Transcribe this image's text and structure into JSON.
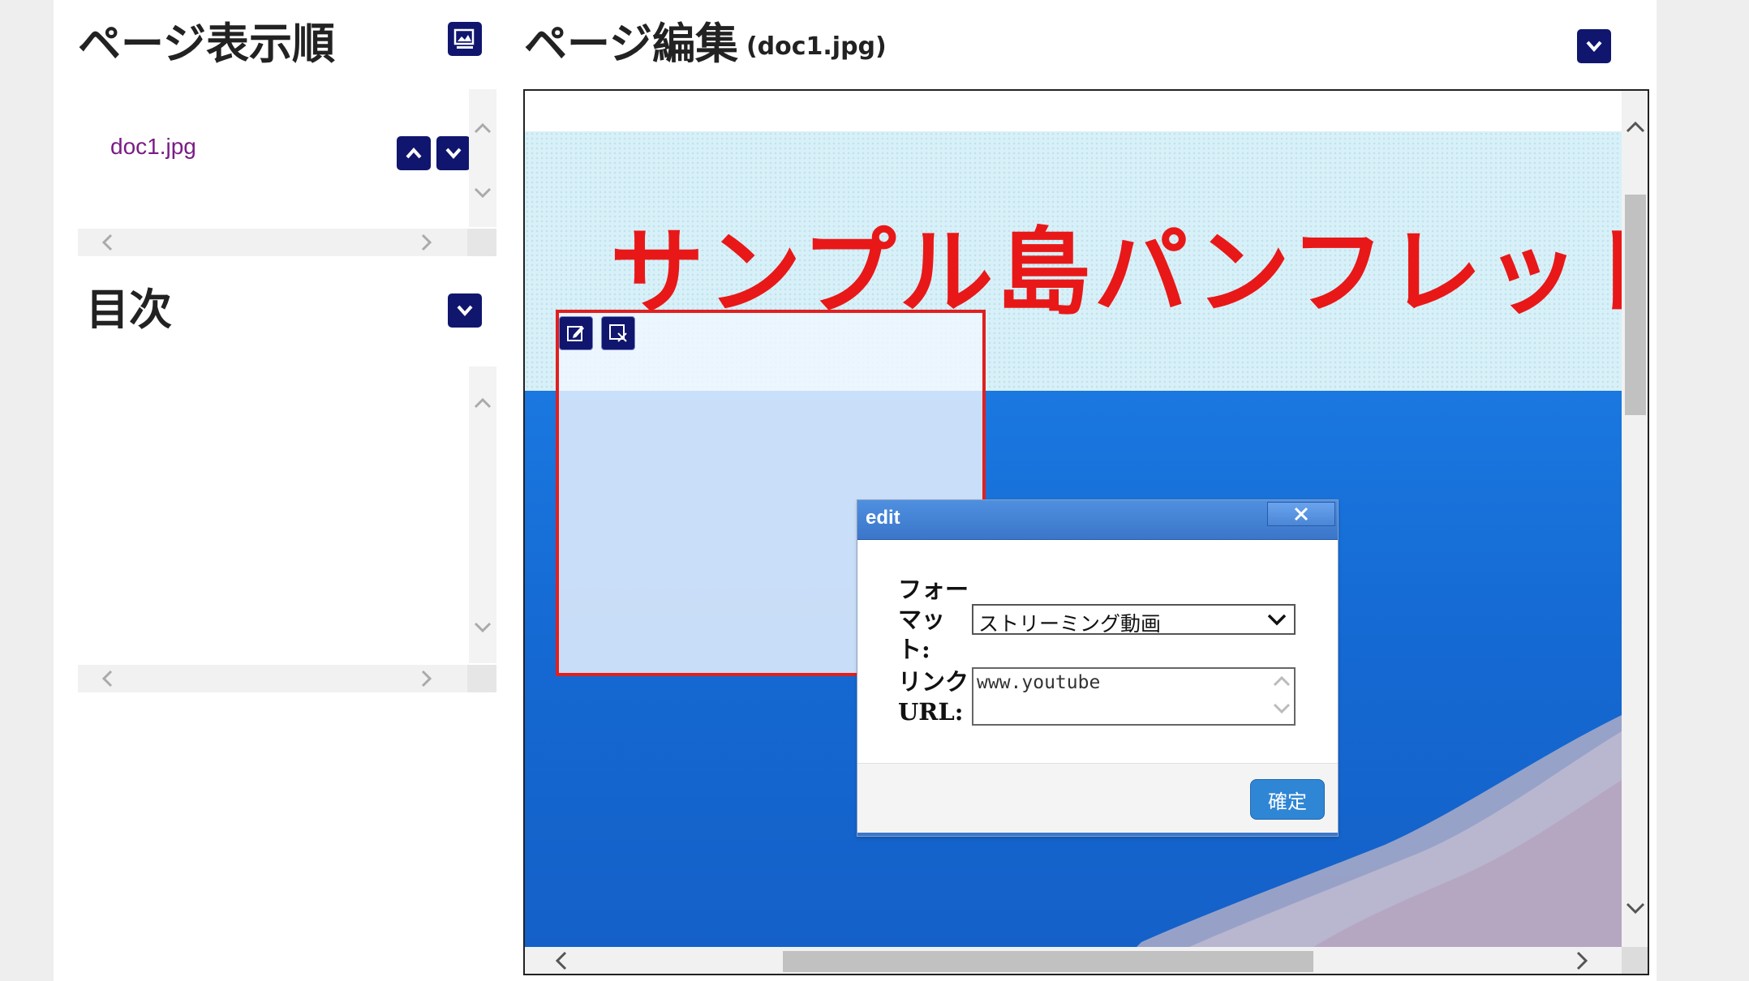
{
  "left_panel": {
    "page_order": {
      "title": "ページ表示順",
      "items": [
        {
          "label": "doc1.jpg"
        }
      ]
    },
    "toc": {
      "title": "目次"
    }
  },
  "editor": {
    "title": "ページ編集",
    "filename": "(doc1.jpg)",
    "banner_text": "サンプル島パンフレット"
  },
  "dialog": {
    "title": "edit",
    "format_label": "フォーマット:",
    "format_value": "ストリーミング動画",
    "link_label": "リンクURL:",
    "link_value": "www.youtube",
    "ok_label": "確定"
  },
  "colors": {
    "navy": "#10166e",
    "banner_red": "#e81818",
    "selection_red": "#e02020",
    "dialog_blue": "#3a76c9",
    "ok_blue": "#2f86d4",
    "link_purple": "#7a1c86"
  },
  "icons": [
    "image-order-icon",
    "chevron-down-icon",
    "chevron-up-icon",
    "edit-icon",
    "delete-icon",
    "close-icon",
    "select-arrow-icon"
  ]
}
